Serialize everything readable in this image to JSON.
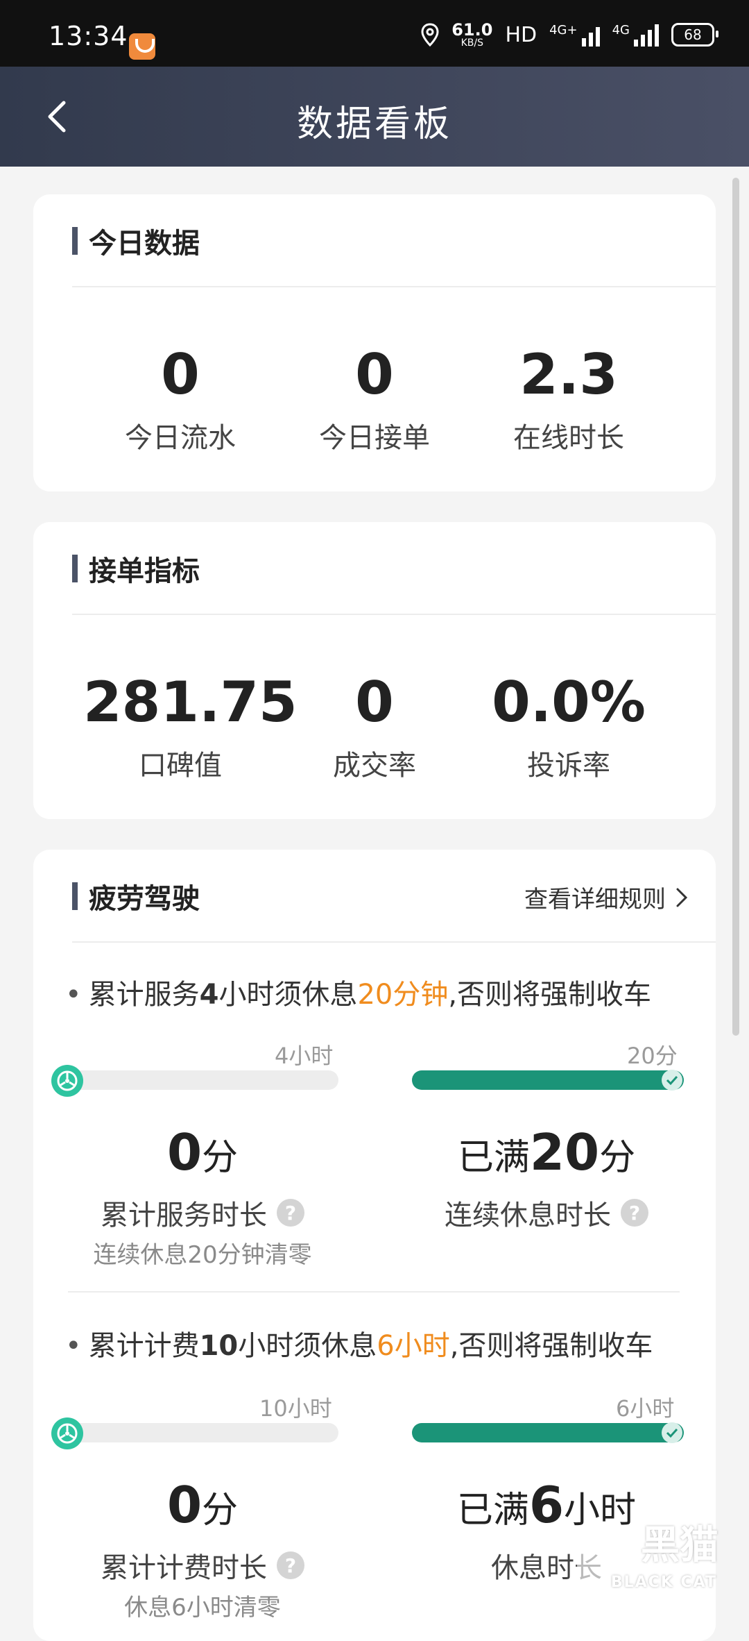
{
  "status_bar": {
    "time": "13:34",
    "net_speed": "61.0",
    "net_unit": "KB/S",
    "hd": "HD",
    "sim1": "4G+",
    "sim2": "4G",
    "battery": "68"
  },
  "nav": {
    "title": "数据看板"
  },
  "today": {
    "title": "今日数据",
    "metrics": [
      {
        "value": "0",
        "label": "今日流水"
      },
      {
        "value": "0",
        "label": "今日接单"
      },
      {
        "value": "2.3",
        "label": "在线时长"
      }
    ]
  },
  "orders": {
    "title": "接单指标",
    "metrics": [
      {
        "value": "281.75",
        "label": "口碑值"
      },
      {
        "value": "0",
        "label": "成交率"
      },
      {
        "value": "0.0%",
        "label": "投诉率"
      }
    ]
  },
  "fatigue": {
    "title": "疲劳驾驶",
    "rules_link": "查看详细规则",
    "rule1": {
      "a": "累计服务",
      "b": "4",
      "c": "小时须休息",
      "d": "20分钟",
      "e": ",否则将强制收车",
      "left_tick": "4小时",
      "right_tick": "20分",
      "service_progress": 0,
      "rest_progress": 1,
      "left_value": "0",
      "left_unit": "分",
      "left_label": "累计服务时长",
      "left_note": "连续休息20分钟清零",
      "right_prefix": "已满",
      "right_value": "20",
      "right_unit": "分",
      "right_label": "连续休息时长"
    },
    "rule2": {
      "a": "累计计费",
      "b": "10",
      "c": "小时须休息",
      "d": "6小时",
      "e": ",否则将强制收车",
      "left_tick": "10小时",
      "right_tick": "6小时",
      "service_progress": 0,
      "rest_progress": 1,
      "left_value": "0",
      "left_unit": "分",
      "left_label": "累计计费时长",
      "left_note": "休息6小时清零",
      "right_prefix": "已满",
      "right_value": "6",
      "right_unit": "小时",
      "right_label": "休息时长"
    }
  },
  "watermark": {
    "text": "黑猫",
    "sub": "BLACK CAT"
  },
  "colors": {
    "accent_orange": "#f08c1e",
    "progress_green": "#1b9478",
    "wheel_green": "#2ec4a0",
    "nav_bg": "#3a4156"
  }
}
